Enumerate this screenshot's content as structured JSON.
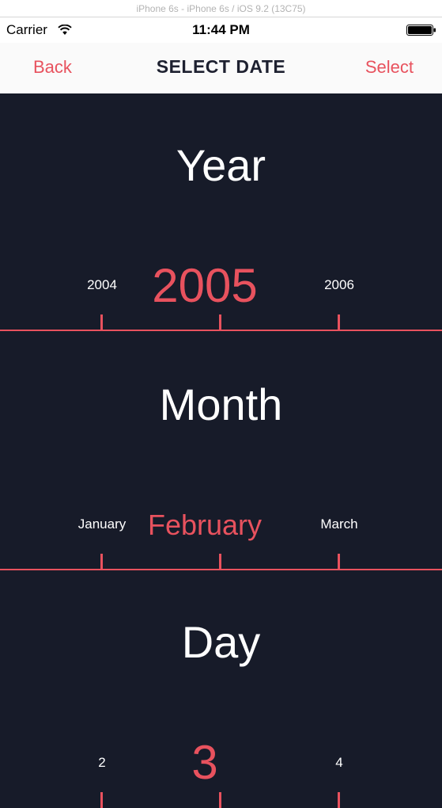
{
  "simulator": {
    "title": "iPhone 6s - iPhone 6s / iOS 9.2 (13C75)"
  },
  "status_bar": {
    "carrier": "Carrier",
    "time": "11:44 PM",
    "wifi_icon": "wifi-icon",
    "battery_icon": "battery-icon"
  },
  "nav": {
    "back_label": "Back",
    "title": "SELECT DATE",
    "select_label": "Select"
  },
  "colors": {
    "accent": "#e8525e",
    "background": "#171b29",
    "nav_background": "#fafafa"
  },
  "pickers": {
    "year": {
      "title": "Year",
      "prev": "2004",
      "current": "2005",
      "next": "2006"
    },
    "month": {
      "title": "Month",
      "prev": "January",
      "current": "February",
      "next": "March"
    },
    "day": {
      "title": "Day",
      "prev": "2",
      "current": "3",
      "next": "4"
    }
  }
}
